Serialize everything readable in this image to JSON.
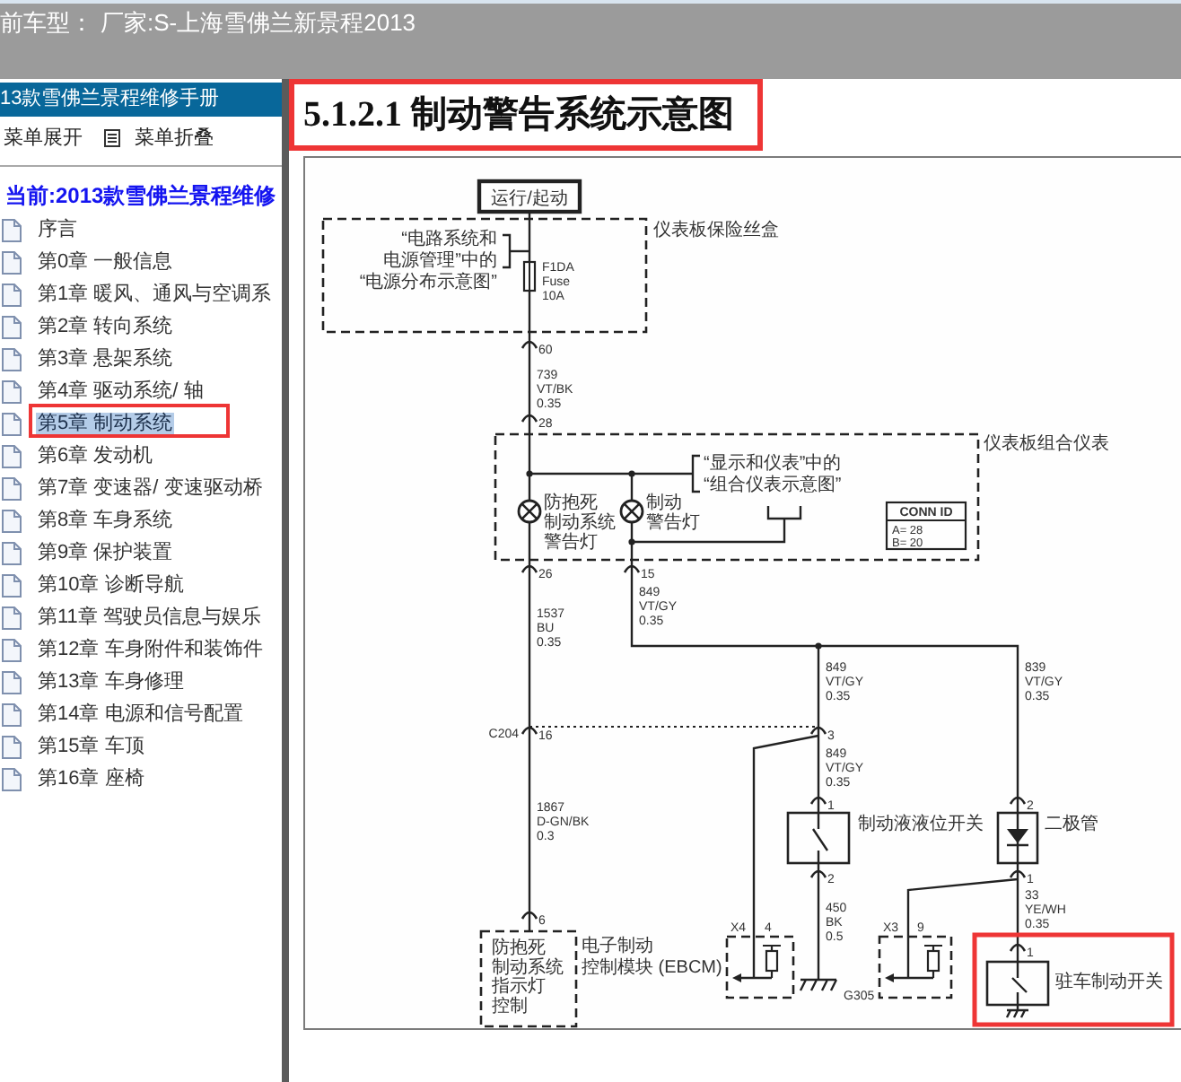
{
  "header": {
    "model_label": "前车型：",
    "maker": "厂家:S-上海雪佛兰新景程2013"
  },
  "sidebar": {
    "title": "13款雪佛兰景程维修手册",
    "actions": [
      {
        "kind": "expand",
        "label": "菜单展开"
      },
      {
        "kind": "collapse",
        "label": "菜单折叠"
      }
    ],
    "current": "当前:2013款雪佛兰景程维修",
    "items": [
      {
        "label": "序言",
        "selected": false,
        "annotated": false
      },
      {
        "label": "第0章 一般信息",
        "selected": false,
        "annotated": false
      },
      {
        "label": "第1章 暖风、通风与空调系",
        "selected": false,
        "annotated": false
      },
      {
        "label": "第2章 转向系统",
        "selected": false,
        "annotated": false
      },
      {
        "label": "第3章 悬架系统",
        "selected": false,
        "annotated": false
      },
      {
        "label": "第4章 驱动系统/ 轴",
        "selected": false,
        "annotated": false
      },
      {
        "label": "第5章 制动系统",
        "selected": true,
        "annotated": true
      },
      {
        "label": "第6章 发动机",
        "selected": false,
        "annotated": false
      },
      {
        "label": "第7章 变速器/ 变速驱动桥",
        "selected": false,
        "annotated": false
      },
      {
        "label": "第8章 车身系统",
        "selected": false,
        "annotated": false
      },
      {
        "label": "第9章 保护装置",
        "selected": false,
        "annotated": false
      },
      {
        "label": "第10章 诊断导航",
        "selected": false,
        "annotated": false
      },
      {
        "label": "第11章 驾驶员信息与娱乐",
        "selected": false,
        "annotated": false
      },
      {
        "label": "第12章 车身附件和装饰件",
        "selected": false,
        "annotated": false
      },
      {
        "label": "第13章 车身修理",
        "selected": false,
        "annotated": false
      },
      {
        "label": "第14章 电源和信号配置",
        "selected": false,
        "annotated": false
      },
      {
        "label": "第15章 车顶",
        "selected": false,
        "annotated": false
      },
      {
        "label": "第16章 座椅",
        "selected": false,
        "annotated": false
      }
    ]
  },
  "content": {
    "heading": {
      "text": "5.1.2.1 制动警告系统示意图",
      "annotated": true
    },
    "diagram": {
      "supply": "运行/起动",
      "fuse_block": {
        "title": "仪表板保险丝盒",
        "reference": [
          "“电路系统和",
          "电源管理”中的",
          "“电源分布示意图”"
        ],
        "fuse": [
          "F1DA",
          "Fuse",
          "10A"
        ]
      },
      "cluster": {
        "title": "仪表板组合仪表",
        "reference": [
          "“显示和仪表”中的",
          "“组合仪表示意图”"
        ],
        "lamps": [
          {
            "lines": [
              "防抱死",
              "制动系统",
              "警告灯"
            ]
          },
          {
            "lines": [
              "制动",
              "警告灯"
            ]
          }
        ],
        "conn_id": {
          "title": "CONN ID",
          "rows": [
            "A= 28",
            "B= 20"
          ]
        }
      },
      "splice": "C204",
      "pins": [
        "60",
        "28",
        "26",
        "15",
        "16",
        "3",
        "1",
        "2",
        "2",
        "1",
        "1",
        "6"
      ],
      "wires": [
        {
          "lines": [
            "739",
            "VT/BK",
            "0.35"
          ]
        },
        {
          "lines": [
            "849",
            "VT/GY",
            "0.35"
          ]
        },
        {
          "lines": [
            "1537",
            "BU",
            "0.35"
          ]
        },
        {
          "lines": [
            "849",
            "VT/GY",
            "0.35"
          ]
        },
        {
          "lines": [
            "839",
            "VT/GY",
            "0.35"
          ]
        },
        {
          "lines": [
            "849",
            "VT/GY",
            "0.35"
          ]
        },
        {
          "lines": [
            "1867",
            "D-GN/BK",
            "0.3"
          ]
        },
        {
          "lines": [
            "450",
            "BK",
            "0.5"
          ]
        },
        {
          "lines": [
            "33",
            "YE/WH",
            "0.35"
          ]
        }
      ],
      "components": [
        {
          "kind": "switch",
          "label": "制动液液位开关",
          "annotated": false
        },
        {
          "kind": "diode",
          "label": "二极管",
          "annotated": false
        },
        {
          "kind": "switch",
          "label": "驻车制动开关",
          "annotated": true
        }
      ],
      "module": {
        "function": [
          "防抱死",
          "制动系统",
          "指示灯",
          "控制"
        ],
        "title": [
          "电子制动",
          "控制模块 (EBCM)"
        ]
      },
      "test_points": [
        {
          "name": "X4",
          "pin": "4"
        },
        {
          "name": "X3",
          "pin": "9"
        }
      ],
      "ground": "G305"
    }
  }
}
